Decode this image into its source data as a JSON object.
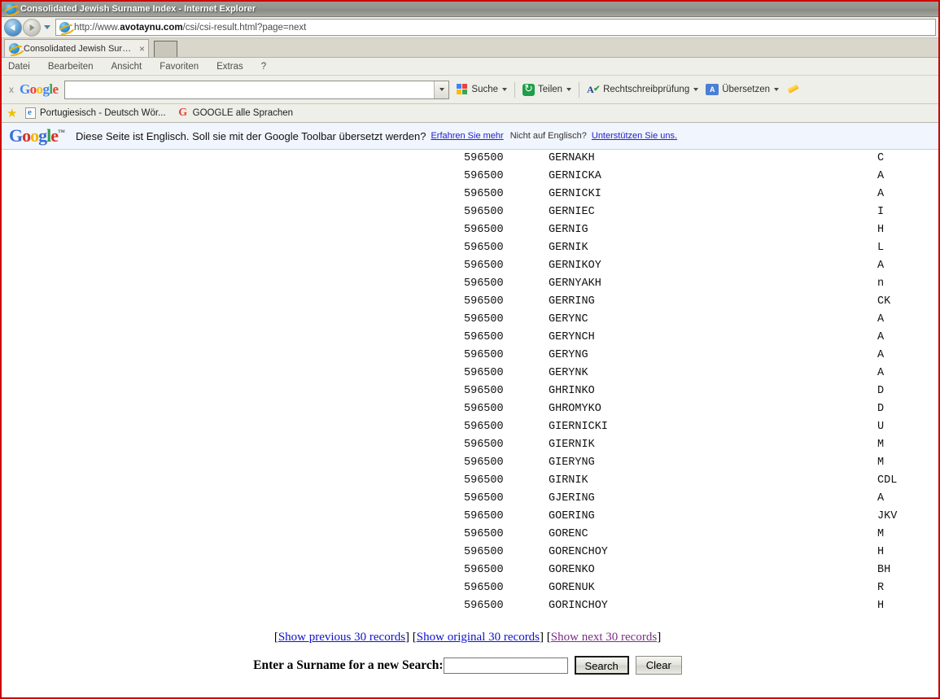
{
  "window": {
    "title": "Consolidated Jewish Surname Index - Internet Explorer",
    "border_color": "#cc0000"
  },
  "address_bar": {
    "url_prefix": "http://www.",
    "url_domain": "avotaynu.com",
    "url_suffix": "/csi/csi-result.html?page=next",
    "full_url": "http://www.avotaynu.com/csi/csi-result.html?page=next",
    "back_icon": "back-arrow-icon",
    "forward_icon": "forward-arrow-icon",
    "history_icon": "chevron-down-icon"
  },
  "tabs": {
    "items": [
      {
        "label": "Consolidated Jewish Surnam...",
        "close_glyph": "×"
      }
    ],
    "new_tab_label": ""
  },
  "menu": {
    "items": [
      "Datei",
      "Bearbeiten",
      "Ansicht",
      "Favoriten",
      "Extras",
      "?"
    ]
  },
  "google_toolbar": {
    "close_glyph": "x",
    "logo": {
      "g1": "G",
      "o1": "o",
      "o2": "o",
      "g2": "g",
      "l": "l",
      "e": "e"
    },
    "search_value": "",
    "search_placeholder": "",
    "dropdown_icon": "chevron-down-icon",
    "buttons": [
      {
        "label": "Suche",
        "icon": "google-squares-icon",
        "has_caret": true
      },
      {
        "label": "Teilen",
        "icon": "share-icon",
        "has_caret": true
      },
      {
        "label": "Rechtschreibprüfung",
        "icon": "spellcheck-icon",
        "has_caret": true
      },
      {
        "label": "Übersetzen",
        "icon": "translate-icon",
        "has_caret": true
      }
    ],
    "pencil_icon": "highlighter-pencil-icon"
  },
  "favorites_bar": {
    "star_icon": "favorites-star-icon",
    "items": [
      {
        "label": "Portugiesisch - Deutsch Wör...",
        "icon": "ie-document-icon"
      },
      {
        "label": "GOOGLE alle Sprachen",
        "icon": "google-g-icon"
      }
    ]
  },
  "translate_bar": {
    "logo_text": "Google",
    "logo_tm": "™",
    "message": "Diese Seite ist Englisch. Soll sie mit der Google Toolbar übersetzt werden?",
    "learn_more": "Erfahren Sie mehr",
    "not_english": "Nicht auf Englisch?",
    "support_us": "Unterstützen Sie uns."
  },
  "results": {
    "rows": [
      {
        "id": "596500",
        "surname": "GERNAKH",
        "code": "C"
      },
      {
        "id": "596500",
        "surname": "GERNICKA",
        "code": "A"
      },
      {
        "id": "596500",
        "surname": "GERNICKI",
        "code": "A"
      },
      {
        "id": "596500",
        "surname": "GERNIEC",
        "code": "I"
      },
      {
        "id": "596500",
        "surname": "GERNIG",
        "code": "H"
      },
      {
        "id": "596500",
        "surname": "GERNIK",
        "code": "L"
      },
      {
        "id": "596500",
        "surname": "GERNIKOY",
        "code": "A"
      },
      {
        "id": "596500",
        "surname": "GERNYAKH",
        "code": "n"
      },
      {
        "id": "596500",
        "surname": "GERRING",
        "code": "CK"
      },
      {
        "id": "596500",
        "surname": "GERYNC",
        "code": "A"
      },
      {
        "id": "596500",
        "surname": "GERYNCH",
        "code": "A"
      },
      {
        "id": "596500",
        "surname": "GERYNG",
        "code": "A"
      },
      {
        "id": "596500",
        "surname": "GERYNK",
        "code": "A"
      },
      {
        "id": "596500",
        "surname": "GHRINKO",
        "code": "D"
      },
      {
        "id": "596500",
        "surname": "GHROMYKO",
        "code": "D"
      },
      {
        "id": "596500",
        "surname": "GIERNICKI",
        "code": "U"
      },
      {
        "id": "596500",
        "surname": "GIERNIK",
        "code": "M"
      },
      {
        "id": "596500",
        "surname": "GIERYNG",
        "code": "M"
      },
      {
        "id": "596500",
        "surname": "GIRNIK",
        "code": "CDL"
      },
      {
        "id": "596500",
        "surname": "GJERING",
        "code": "A"
      },
      {
        "id": "596500",
        "surname": "GOERING",
        "code": "JKV"
      },
      {
        "id": "596500",
        "surname": "GORENC",
        "code": "M"
      },
      {
        "id": "596500",
        "surname": "GORENCHOY",
        "code": "H"
      },
      {
        "id": "596500",
        "surname": "GORENKO",
        "code": "BH"
      },
      {
        "id": "596500",
        "surname": "GORENUK",
        "code": "R"
      },
      {
        "id": "596500",
        "surname": "GORINCHOY",
        "code": "H"
      }
    ]
  },
  "pager": {
    "open": "[",
    "close": "]",
    "previous": "Show previous 30 records",
    "original": "Show original 30 records",
    "next": "Show next 30 records",
    "link_color": "#1111cc",
    "visited_color": "#7b2e86"
  },
  "search_form": {
    "label": "Enter a Surname for a new Search:",
    "input_value": "",
    "input_placeholder": "",
    "search_button": "Search",
    "clear_button": "Clear"
  }
}
